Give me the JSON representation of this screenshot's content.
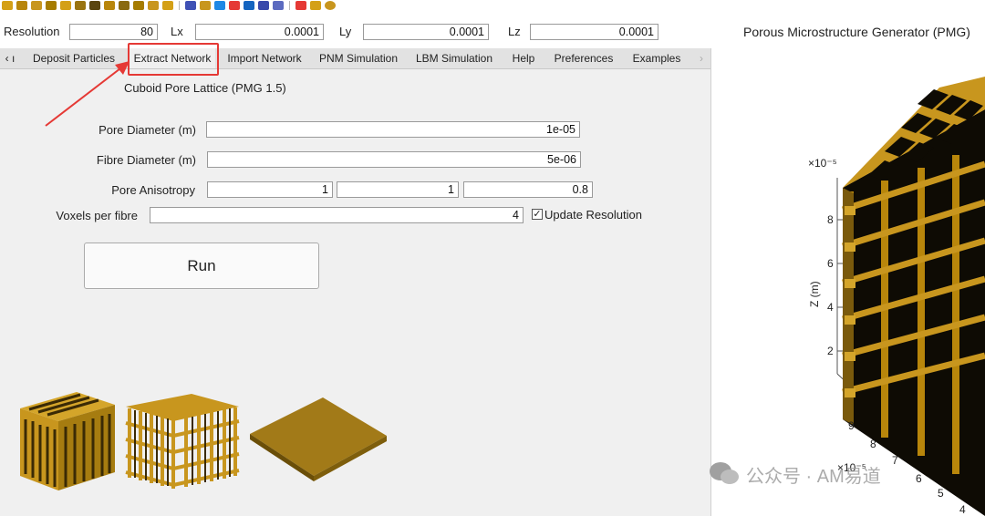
{
  "resolution_row": {
    "resolution_label": "Resolution",
    "resolution_value": "80",
    "lx_label": "Lx",
    "lx_value": "0.0001",
    "ly_label": "Ly",
    "ly_value": "0.0001",
    "lz_label": "Lz",
    "lz_value": "0.0001"
  },
  "tabs": [
    {
      "label": "‹ ı"
    },
    {
      "label": "Deposit Particles"
    },
    {
      "label": "Extract Network"
    },
    {
      "label": "Import Network"
    },
    {
      "label": "PNM Simulation"
    },
    {
      "label": "LBM Simulation"
    },
    {
      "label": "Help"
    },
    {
      "label": "Preferences"
    },
    {
      "label": "Examples"
    },
    {
      "label": "›"
    }
  ],
  "active_tab": "Extract Network",
  "panel": {
    "heading": "Cuboid Pore Lattice (PMG 1.5)",
    "pore_diameter_label": "Pore Diameter (m)",
    "pore_diameter_value": "1e-05",
    "fibre_diameter_label": "Fibre Diameter (m)",
    "fibre_diameter_value": "5e-06",
    "pore_anisotropy_label": "Pore Anisotropy",
    "pore_anisotropy_values": [
      "1",
      "1",
      "0.8"
    ],
    "voxels_label": "Voxels per fibre",
    "voxels_value": "4",
    "update_resolution_label": "Update Resolution",
    "update_resolution_checked": true,
    "run_label": "Run"
  },
  "plot": {
    "title": "Porous Microstructure Generator (PMG)",
    "z_scale": "×10⁻⁵",
    "z_label": "Z (m)",
    "z_ticks": [
      "8",
      "6",
      "4",
      "2"
    ],
    "x_scale": "×10⁻⁵",
    "x_ticks": [
      "9",
      "8",
      "7",
      "6",
      "5",
      "4"
    ]
  },
  "colors": {
    "fibre_gold": "#c8961e",
    "fibre_dark": "#7a5a0c",
    "highlight_red": "#e53935"
  },
  "watermark": {
    "text": "公众号 · AM易道"
  }
}
